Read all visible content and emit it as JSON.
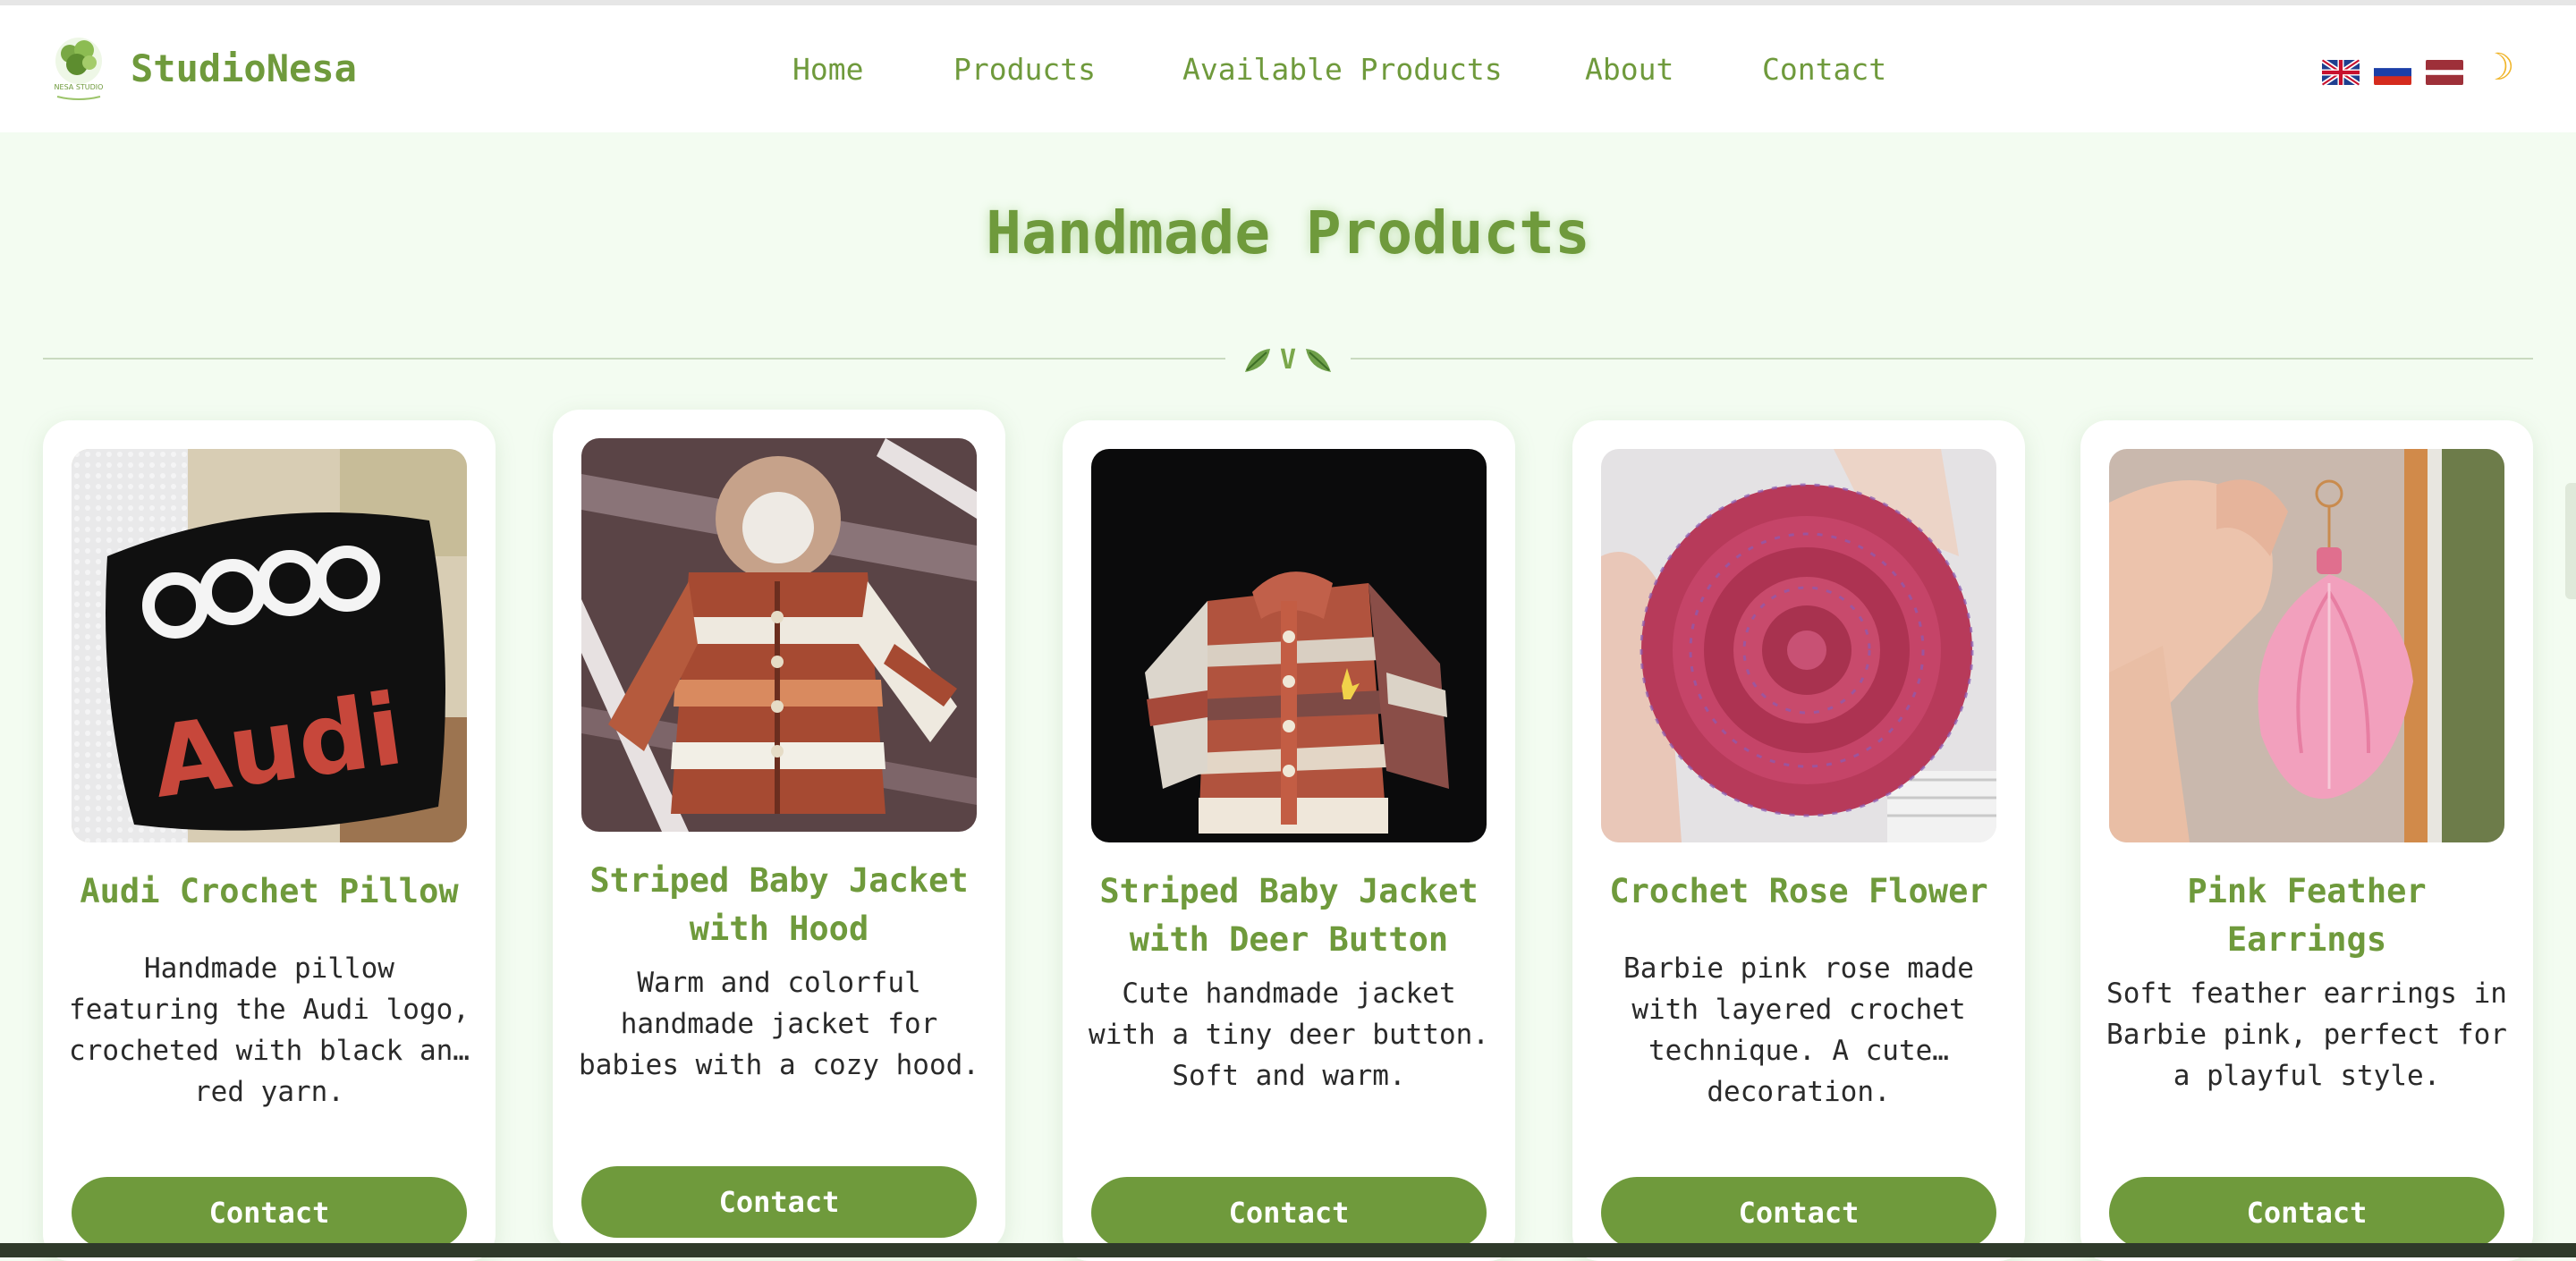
{
  "brand": {
    "name": "StudioNesa",
    "logo_text": "NESA STUDIO"
  },
  "nav": {
    "items": [
      "Home",
      "Products",
      "Available Products",
      "About",
      "Contact"
    ]
  },
  "languages": [
    "en-flag-icon",
    "ru-flag-icon",
    "lv-flag-icon"
  ],
  "theme_toggle_icon": "moon-icon",
  "page": {
    "title": "Handmade Products",
    "divider_letter": "V"
  },
  "colors": {
    "accent": "#6f9a3c",
    "background": "#f3fcf1",
    "card": "#ffffff",
    "button_text": "#ffffff"
  },
  "products": [
    {
      "title": "Audi Crochet Pillow",
      "description": "Handmade pillow featuring the Audi logo, crocheted with black an… red yarn.",
      "button": "Contact"
    },
    {
      "title": "Striped Baby Jacket with Hood",
      "description": "Warm and colorful handmade jacket for babies with a cozy hood.",
      "button": "Contact"
    },
    {
      "title": "Striped Baby Jacket with Deer Button",
      "description": "Cute handmade jacket with a tiny deer button. Soft and warm.",
      "button": "Contact"
    },
    {
      "title": "Crochet Rose Flower",
      "description": "Barbie pink rose made with layered crochet technique. A cute… decoration.",
      "button": "Contact"
    },
    {
      "title": "Pink Feather Earrings",
      "description": "Soft feather earrings in Barbie pink, perfect for a playful style.",
      "button": "Contact"
    }
  ]
}
